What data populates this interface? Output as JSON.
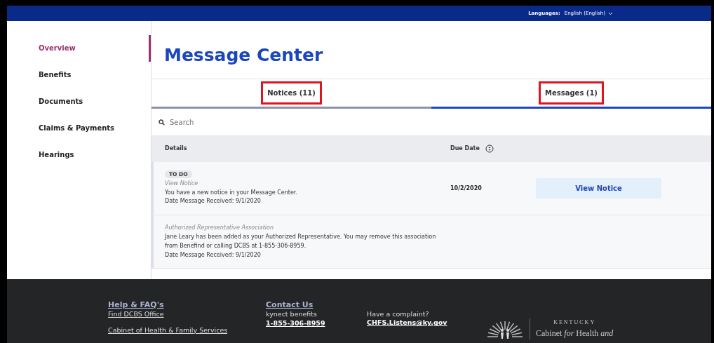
{
  "top_bar": {
    "language_label": "Languages:",
    "language_value": "English (English)"
  },
  "sidebar": {
    "items": [
      {
        "label": "Overview",
        "selected": true
      },
      {
        "label": "Benefits",
        "selected": false
      },
      {
        "label": "Documents",
        "selected": false
      },
      {
        "label": "Claims & Payments",
        "selected": false
      },
      {
        "label": "Hearings",
        "selected": false
      }
    ]
  },
  "title": "Message Center",
  "tabs": [
    {
      "label": "Notices (11)",
      "selected": false,
      "highlighted": true
    },
    {
      "label": "Messages (1)",
      "selected": true,
      "highlighted": true
    }
  ],
  "search": {
    "placeholder": "Search"
  },
  "table": {
    "columns": [
      "Details",
      "Due Date"
    ],
    "rows": [
      {
        "badge": "TO DO",
        "subject": "View Notice",
        "body": "You have a new notice in your Message Center.",
        "received": "Date Message Received: 9/1/2020",
        "due_date": "10/2/2020",
        "action": "View Notice"
      },
      {
        "subject": "Authorized Representative Association",
        "body": "Jane Leary has been added as your Authorized Representative. You may remove this association from Benefind or calling DCBS at 1-855-306-8959.",
        "received": "Date Message Received: 9/1/2020"
      }
    ]
  },
  "footer": {
    "columns": [
      {
        "heading": "Help & FAQ's",
        "links": [
          "Find DCBS Office",
          "Cabinet of Health & Family Services"
        ]
      },
      {
        "heading": "Contact Us",
        "text": "kynect benefits",
        "link": "1-855-306-8959"
      },
      {
        "text": "Have a complaint?",
        "link": "CHFS.Listens@ky.gov"
      }
    ],
    "logo": {
      "state": "KENTUCKY",
      "name": "Cabinet *for* Health *and*"
    }
  }
}
